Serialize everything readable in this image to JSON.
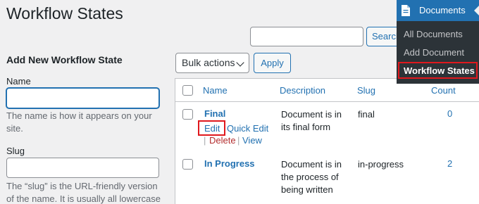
{
  "page": {
    "title": "Workflow States"
  },
  "search": {
    "value": "",
    "button_label": "Search"
  },
  "form": {
    "title": "Add New Workflow State",
    "name_label": "Name",
    "name_value": "",
    "name_help": "The name is how it appears on your site.",
    "slug_label": "Slug",
    "slug_value": "",
    "slug_help": "The “slug” is the URL-friendly version of the name. It is usually all lowercase"
  },
  "toolbar": {
    "bulk_actions": "Bulk actions",
    "apply_label": "Apply"
  },
  "table": {
    "columns": [
      "Name",
      "Description",
      "Slug",
      "Count"
    ],
    "rows": [
      {
        "name": "Final",
        "description": "Document is in its final form",
        "slug": "final",
        "count": "0",
        "actions": {
          "edit": "Edit",
          "quick_edit": "Quick Edit",
          "delete": "Delete",
          "view": "View"
        },
        "separator": "|"
      },
      {
        "name": "In Progress",
        "description": "Document is in the process of being written",
        "slug": "in-progress",
        "count": "2"
      }
    ]
  },
  "admin_menu": {
    "header": "Documents",
    "header_icon": "document-icon",
    "items": [
      "All Documents",
      "Add Document",
      "Workflow States"
    ],
    "current": "Workflow States"
  },
  "colors": {
    "accent": "#2271b1",
    "highlight": "#e0181d",
    "menu_bg": "#2c3338",
    "delete": "#b32d2e"
  }
}
